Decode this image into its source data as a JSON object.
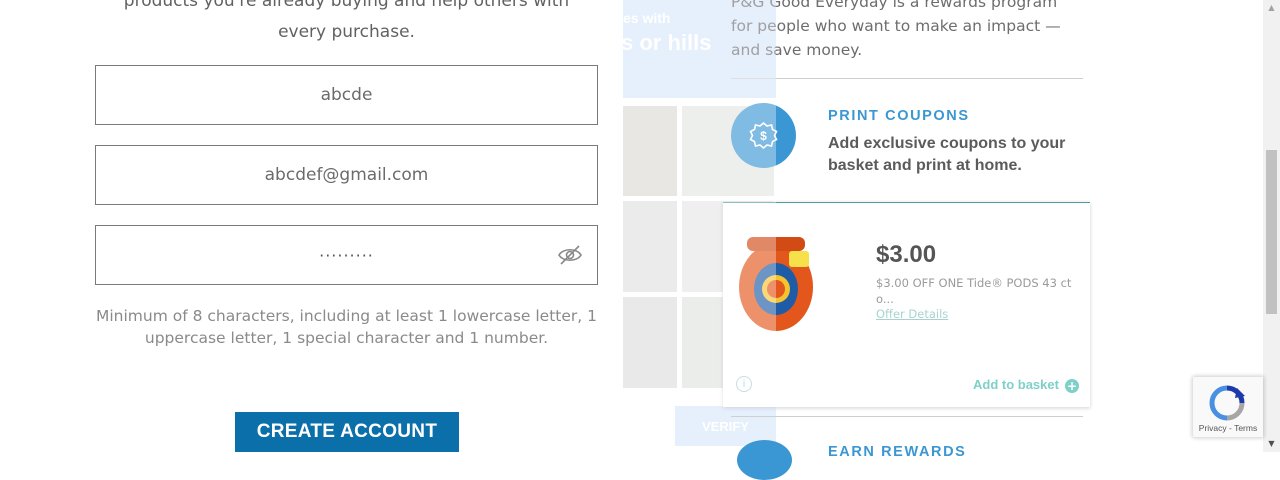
{
  "signup_form": {
    "intro_lines": [
      "products you're already buying and help others with",
      "every purchase."
    ],
    "username_value": "abcde",
    "email_value": "abcdef@gmail.com",
    "password_mask": "·········",
    "password_hint_lines": [
      "Minimum of 8 characters, including at least 1 lowercase letter, 1",
      "uppercase letter, 1 special character and 1 number."
    ],
    "create_account_label": "CREATE ACCOUNT"
  },
  "background_panel": {
    "banner_line1": "es with",
    "banner_line2": "s or hills",
    "verify_label": "VERIFY"
  },
  "info_panel": {
    "description_lines": [
      "P&G Good Everyday is a rewards program",
      "for people who want to make an impact —",
      "and save money."
    ],
    "feature_1": {
      "icon": "dollar-badge-icon",
      "title": "PRINT COUPONS",
      "desc_lines": [
        "Add exclusive coupons to your",
        "basket and print at home."
      ]
    },
    "coupon": {
      "price": "$3.00",
      "offer_lines": [
        "$3.00 OFF ONE Tide® PODS 43 ct",
        "o..."
      ],
      "details_link": "Offer Details",
      "add_label": "Add to basket"
    },
    "feature_2": {
      "title": "EARN REWARDS"
    }
  },
  "recaptcha": {
    "terms": "Privacy - Terms"
  },
  "colors": {
    "primary_blue": "#0b70a9",
    "accent_blue": "#3b97d3",
    "teal": "#7ed1c9"
  }
}
